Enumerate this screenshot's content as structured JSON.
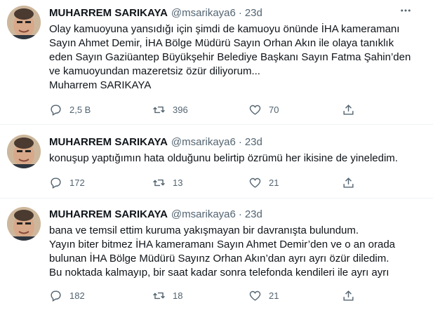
{
  "tweets": [
    {
      "author": "MUHARREM SARIKAYA",
      "handle": "@msarikaya6",
      "separator": "·",
      "time": "23d",
      "lines": [
        "Olay kamuoyuna yansıdığı için şimdi de kamuoyu önünde İHA kameramanı",
        "Sayın Ahmet Demir, İHA Bölge Müdürü Sayın Orhan Akın ile olaya tanıklık",
        "eden Sayın Gaziüantep Büyükşehir Belediye Başkanı Sayın Fatma Şahin’den",
        "ve kamuoyundan  mazeretsiz özür diliyorum...",
        "Muharrem SARIKAYA"
      ],
      "replies": "2,5 B",
      "retweets": "396",
      "likes": "70"
    },
    {
      "author": "MUHARREM SARIKAYA",
      "handle": "@msarikaya6",
      "separator": "·",
      "time": "23d",
      "lines": [
        "konuşup yaptığımın hata olduğunu belirtip özrümü her ikisine de yineledim."
      ],
      "replies": "172",
      "retweets": "13",
      "likes": "21"
    },
    {
      "author": "MUHARREM SARIKAYA",
      "handle": "@msarikaya6",
      "separator": "·",
      "time": "23d",
      "lines": [
        "bana ve temsil ettim kuruma yakışmayan bir davranışta bulundum.",
        "Yayın biter bitmez İHA kameramanı Sayın Ahmet Demir’den ve o an orada",
        "bulunan İHA Bölge Müdürü Sayınz Orhan Akın’dan ayrı ayrı özür diledim.",
        "Bu noktada kalmayıp, bir saat kadar sonra telefonda kendileri ile ayrı ayrı"
      ],
      "replies": "182",
      "retweets": "18",
      "likes": "21"
    }
  ],
  "icons": {
    "more": "more-options-icon",
    "reply": "reply-icon",
    "retweet": "retweet-icon",
    "like": "heart-icon",
    "share": "share-icon"
  },
  "colors": {
    "text": "#0f1419",
    "secondary": "#536471",
    "divider": "#eff3f4"
  }
}
